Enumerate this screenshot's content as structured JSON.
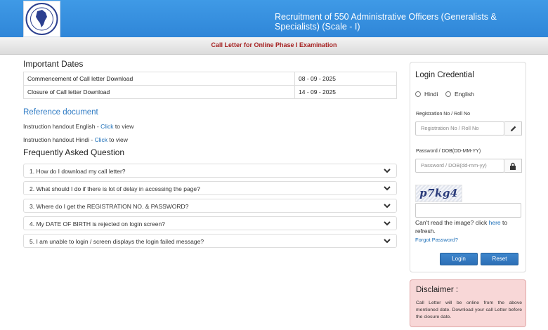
{
  "header": {
    "title": "Recruitment of 550 Administrative Officers (Generalists & Specialists) (Scale - I)",
    "logo_icon": "company-emblem-icon"
  },
  "subbar": {
    "text": "Call Letter for Online Phase I Examination"
  },
  "important_dates": {
    "heading": "Important Dates",
    "rows": [
      {
        "label": "Commencement of Call letter Download",
        "date": "08 - 09 - 2025"
      },
      {
        "label": "Closure of Call letter Download",
        "date": "14 - 09 - 2025"
      }
    ]
  },
  "reference": {
    "heading": "Reference document",
    "items": [
      {
        "prefix": "Instruction handout English - ",
        "link": "Click",
        "suffix": " to view"
      },
      {
        "prefix": "Instruction handout Hindi - ",
        "link": "Click",
        "suffix": " to view"
      }
    ]
  },
  "faq": {
    "heading": "Frequently Asked Question",
    "items": [
      "1. How do I download my call letter?",
      "2. What should I do if there is lot of delay in accessing the page?",
      "3. Where do I get the REGISTRATION NO. & PASSWORD?",
      "4. My DATE OF BIRTH is rejected on login screen?",
      "5. I am unable to login / screen displays the login failed message?"
    ]
  },
  "login": {
    "title": "Login Credential",
    "lang_hindi": "Hindi",
    "lang_english": "English",
    "reg_label": "Registration No / Roll No",
    "reg_placeholder": "Registration No / Roll No",
    "dob_label": "Password / DOB(DD-MM-YY)",
    "dob_placeholder": "Password / DOB(dd-mm-yy)",
    "captcha_text": "p7kg4",
    "cant_read_prefix": "Can't read the image? click ",
    "cant_read_link": "here",
    "cant_read_suffix": " to refresh.",
    "forgot": "Forgot Password?",
    "login_button": "Login",
    "reset_button": "Reset"
  },
  "disclaimer": {
    "title": "Disclaimer :",
    "text": "Call Letter will be online from the above mentioned date. Download your call Letter before the closure date."
  },
  "colors": {
    "header_blue": "#3a92e0",
    "subbar_text": "#a52020",
    "link_blue": "#1d6fb8",
    "button_blue": "#3477bf",
    "disclaimer_bg": "#f8d7d7"
  }
}
